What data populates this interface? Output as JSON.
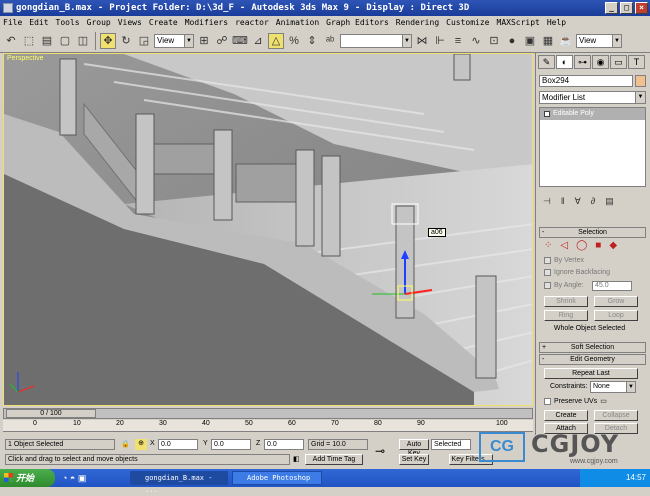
{
  "window": {
    "file": "gongdian_B.max",
    "project": "Project Folder: D:\\3d_F",
    "app": "Autodesk 3ds Max 9",
    "display": "Display : Direct 3D",
    "sep": "-"
  },
  "menu": [
    "File",
    "Edit",
    "Tools",
    "Group",
    "Views",
    "Create",
    "Modifiers",
    "reactor",
    "Animation",
    "Graph Editors",
    "Rendering",
    "Customize",
    "MAXScript",
    "Help"
  ],
  "toolbar": {
    "coord_select": "View",
    "right_select": "View"
  },
  "viewport": {
    "label": "Perspective",
    "tooltip": "a06"
  },
  "command_panel": {
    "object_name": "Box294",
    "modifier_list": "Modifier List",
    "stack_item": "Editable Poly",
    "selection_rollout": "Selection",
    "by_vertex": "By Vertex",
    "ignore_backfacing": "Ignore Backfacing",
    "by_angle": "By Angle:",
    "angle_value": "45.0",
    "shrink": "Shrink",
    "grow": "Grow",
    "ring": "Ring",
    "loop": "Loop",
    "whole_selected": "Whole Object Selected",
    "soft_selection": "Soft Selection",
    "edit_geometry": "Edit Geometry",
    "repeat_last": "Repeat Last",
    "constraints": "Constraints:",
    "constraints_value": "None",
    "preserve_uvs": "Preserve UVs",
    "create": "Create",
    "collapse": "Collapse",
    "attach": "Attach",
    "detach": "Detach",
    "pm_minus": "-",
    "pm_plus": "+"
  },
  "timeline": {
    "frame": "0 / 100",
    "ticks": [
      "0",
      "10",
      "20",
      "30",
      "40",
      "50",
      "60",
      "70",
      "80",
      "90",
      "100"
    ]
  },
  "status": {
    "selected": "1 Object Selected",
    "prompt": "Click and drag to select and move objects",
    "x_label": "X",
    "x": "0.0",
    "y_label": "Y",
    "y": "0.0",
    "z_label": "Z",
    "z": "0.0",
    "grid": "Grid = 10.0",
    "add_time_tag": "Add Time Tag",
    "auto_key": "Auto Key",
    "auto_key_value": "Selected",
    "set_key": "Set Key",
    "key_filters": "Key Filters..."
  },
  "taskbar": {
    "start": "开始",
    "tasks": [
      "gongdian_B.max - ...",
      "Adobe Photoshop"
    ],
    "clock": "14:57"
  },
  "watermark": {
    "logo": "CG",
    "text": "CGJOY",
    "url": "www.cgjoy.com"
  },
  "colors": {
    "title": "#1a3c9a",
    "viewport_border": "#f0e070",
    "gizmo_y": "#2040ff",
    "gizmo_x": "#ff2020"
  }
}
